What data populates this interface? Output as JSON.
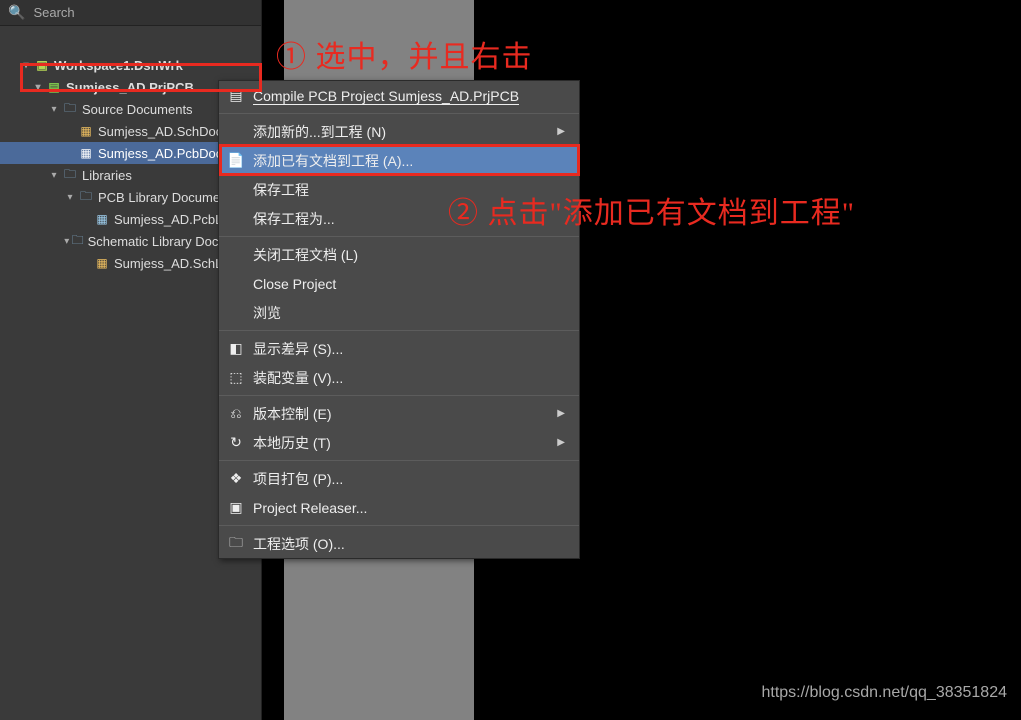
{
  "search": {
    "placeholder": "Search"
  },
  "tree": {
    "workspace": "Workspace1.DsnWrk",
    "project": "Sumjess_AD.PrjPCB",
    "source_docs": "Source Documents",
    "schdoc": "Sumjess_AD.SchDoc",
    "pcbdoc": "Sumjess_AD.PcbDoc",
    "libraries": "Libraries",
    "pcblib_folder": "PCB Library Documents",
    "pcblib": "Sumjess_AD.PcbLib",
    "schlib_folder": "Schematic Library Documents",
    "schlib": "Sumjess_AD.SchLib"
  },
  "menu": {
    "compile": "Compile PCB Project Sumjess_AD.PrjPCB",
    "add_new": "添加新的...到工程 (N)",
    "add_existing": "添加已有文档到工程 (A)...",
    "save_project": "保存工程",
    "save_project_as": "保存工程为...",
    "close_docs": "关闭工程文档 (L)",
    "close_project": "Close Project",
    "browse": "浏览",
    "show_diff": "显示差异 (S)...",
    "assembly_var": "装配变量 (V)...",
    "version_ctrl": "版本控制 (E)",
    "local_history": "本地历史 (T)",
    "pack_project": "项目打包 (P)...",
    "project_releaser": "Project Releaser...",
    "project_options": "工程选项 (O)..."
  },
  "anno": {
    "a1": "① 选中，并且右击",
    "a2": "② 点击\"添加已有文档到工程\""
  },
  "watermark": "https://blog.csdn.net/qq_38351824"
}
